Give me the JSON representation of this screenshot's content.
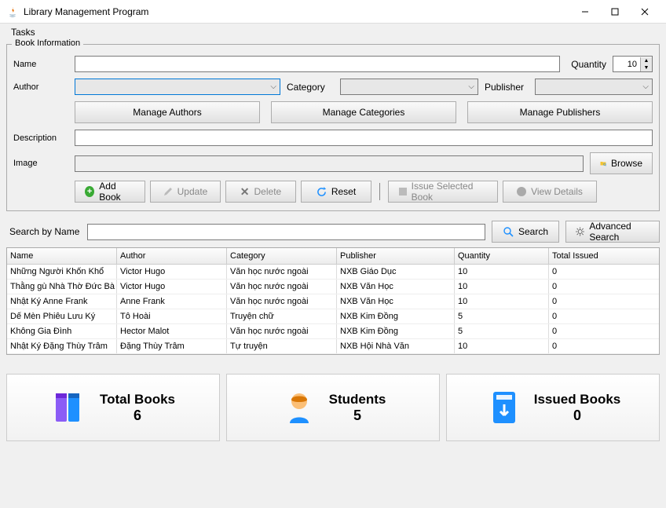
{
  "window": {
    "title": "Library Management Program"
  },
  "menubar": {
    "tasks": "Tasks"
  },
  "fieldset": {
    "title": "Book Information",
    "name_label": "Name",
    "quantity_label": "Quantity",
    "quantity_value": "10",
    "author_label": "Author",
    "category_label": "Category",
    "publisher_label": "Publisher",
    "manage_authors": "Manage Authors",
    "manage_categories": "Manage Categories",
    "manage_publishers": "Manage Publishers",
    "description_label": "Description",
    "image_label": "Image",
    "browse": "Browse"
  },
  "actions": {
    "add": "Add Book",
    "update": "Update",
    "delete": "Delete",
    "reset": "Reset",
    "issue": "Issue Selected Book",
    "view": "View Details"
  },
  "search": {
    "label": "Search by Name",
    "button": "Search",
    "advanced": "Advanced Search"
  },
  "table": {
    "headers": [
      "Name",
      "Author",
      "Category",
      "Publisher",
      "Quantity",
      "Total Issued"
    ],
    "rows": [
      [
        "Những Người Khốn Khổ",
        "Victor Hugo",
        "Văn học nước ngoài",
        "NXB Giáo Dục",
        "10",
        "0"
      ],
      [
        "Thằng gù Nhà Thờ Đức Bà",
        "Victor Hugo",
        "Văn học nước ngoài",
        "NXB Văn Học",
        "10",
        "0"
      ],
      [
        "Nhật Ký Anne Frank",
        "Anne Frank",
        "Văn học nước ngoài",
        "NXB Văn Học",
        "10",
        "0"
      ],
      [
        "Dế Mèn Phiêu Lưu Ký",
        "Tô Hoài",
        "Truyện chữ",
        "NXB Kim Đồng",
        "5",
        "0"
      ],
      [
        "Không Gia Đình",
        "Hector Malot",
        "Văn học nước ngoài",
        "NXB Kim Đồng",
        "5",
        "0"
      ],
      [
        "Nhật Ký Đặng Thùy Trâm",
        "Đặng Thùy Trâm",
        "Tự truyện",
        "NXB Hội Nhà Văn",
        "10",
        "0"
      ]
    ]
  },
  "stats": {
    "total_books_label": "Total Books",
    "total_books_value": "6",
    "students_label": "Students",
    "students_value": "5",
    "issued_label": "Issued Books",
    "issued_value": "0"
  }
}
